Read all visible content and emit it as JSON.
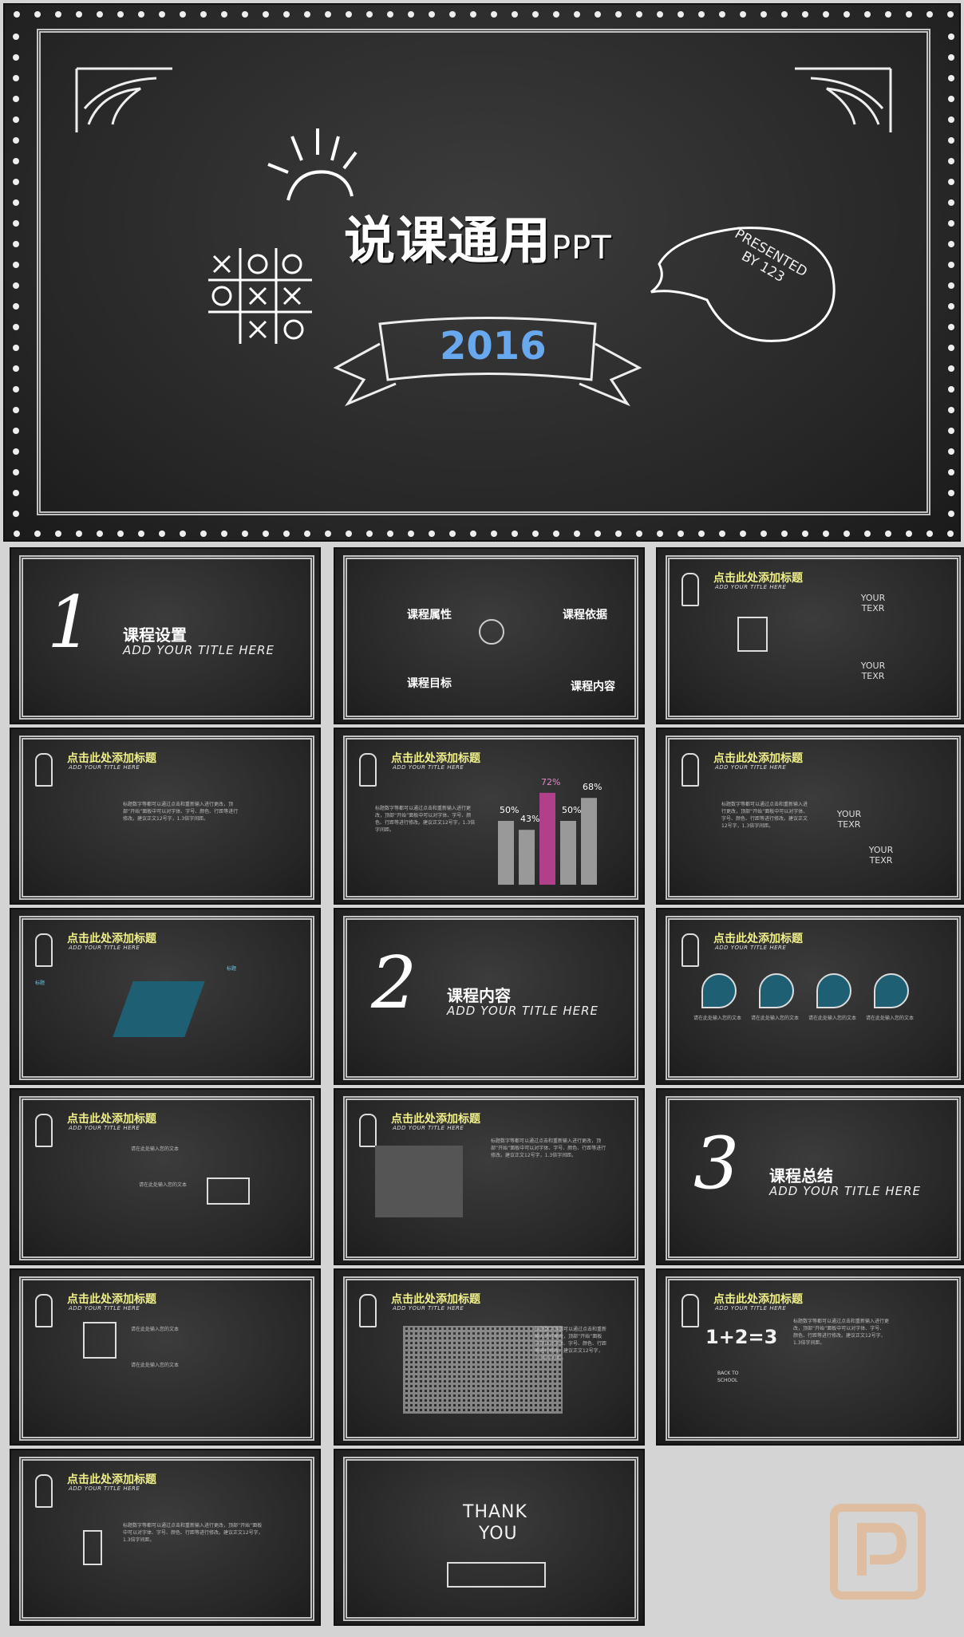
{
  "title_slide": {
    "title_cn": "说课通用",
    "title_en": "PPT",
    "year": "2016",
    "presented": "PRESENTED BY 123"
  },
  "sections": [
    {
      "number": "1",
      "title": "课程设置",
      "subtitle": "ADD YOUR TITLE HERE"
    },
    {
      "number": "2",
      "title": "课程内容",
      "subtitle": "ADD YOUR TITLE HERE"
    },
    {
      "number": "3",
      "title": "课程总结",
      "subtitle": "ADD YOUR TITLE HERE"
    }
  ],
  "agenda": [
    "课程属性",
    "课程依据",
    "课程目标",
    "课程内容"
  ],
  "slide_header": {
    "title": "点击此处添加标题",
    "subtitle": "ADD YOUR TITLE HERE"
  },
  "hex_labels": [
    "YOUR TEXR",
    "YOUR TEXR"
  ],
  "chart_data": {
    "type": "bar",
    "values_label": [
      "50%",
      "43%",
      "72%",
      "50%",
      "68%"
    ],
    "values": [
      50,
      43,
      72,
      50,
      68
    ],
    "highlight_color": "#b0408a"
  },
  "body_text": "标题数字等都可以通过点击和重新输入进行更改，顶部“开始”面板中可以对字体、字号、颜色、行距等进行修改。建议正文12号字，1.3倍字间距。",
  "item_text": "请在此处输入您的文本",
  "item_label": "标题",
  "equation": "1+2=3",
  "back_to_school": "BACK TO SCHOOL",
  "end_slide": {
    "thank": "THANK",
    "you": "YOU"
  },
  "colors": {
    "chalk": "#f2f2f2",
    "accent_yellow": "#f0f08a",
    "accent_teal": "#1f5f74",
    "year_blue": "#68a8ee",
    "bar_pink": "#b0408a"
  }
}
